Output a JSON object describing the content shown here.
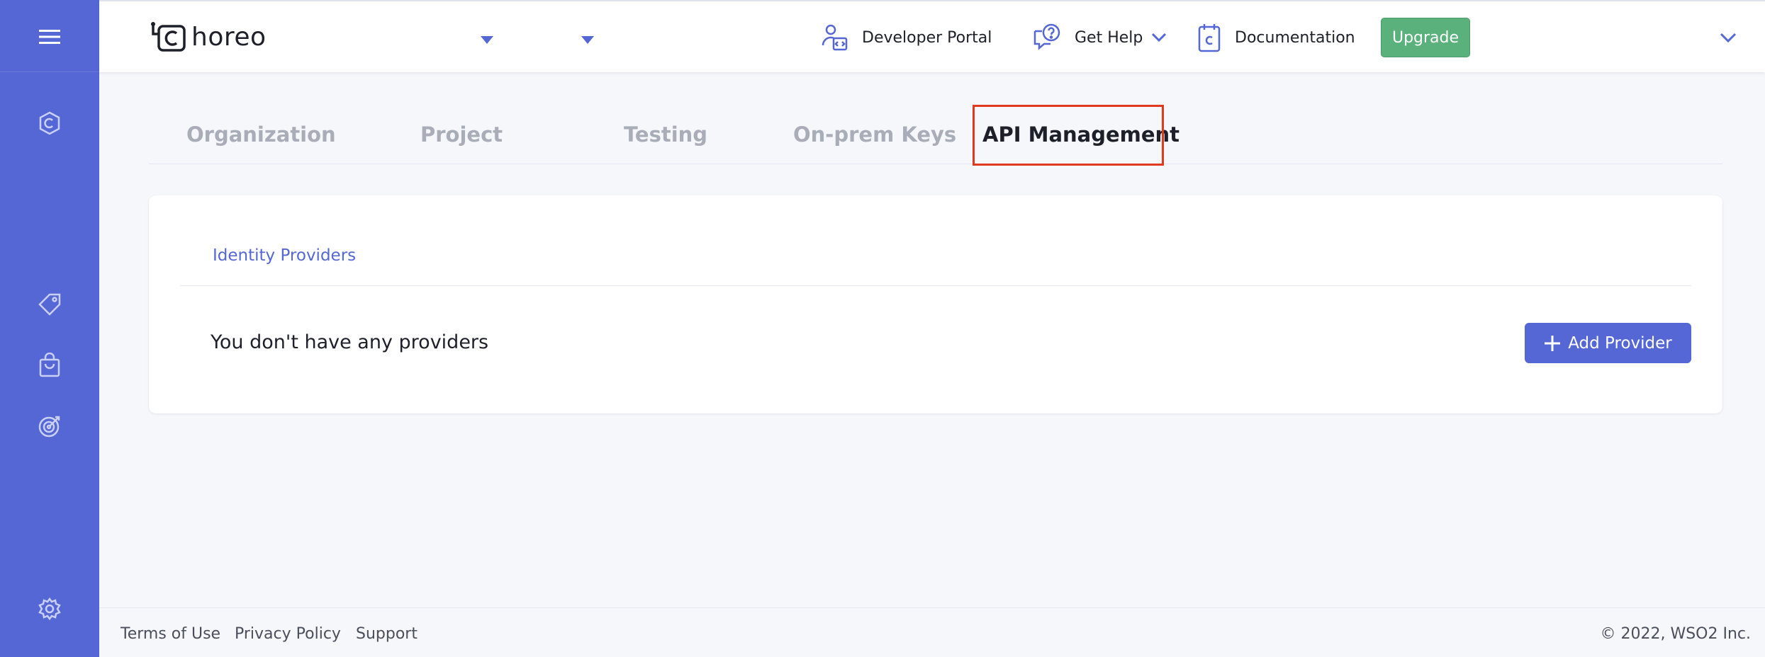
{
  "app": {
    "logo_text": "horeo"
  },
  "header": {
    "developer_portal": "Developer Portal",
    "get_help": "Get Help",
    "documentation": "Documentation",
    "upgrade": "Upgrade"
  },
  "tabs": [
    {
      "label": "Organization",
      "active": false
    },
    {
      "label": "Project",
      "active": false
    },
    {
      "label": "Testing",
      "active": false
    },
    {
      "label": "On-prem Keys",
      "active": false
    },
    {
      "label": "API Management",
      "active": true
    }
  ],
  "card": {
    "subtab": "Identity Providers",
    "empty_message": "You don't have any providers",
    "add_button": "Add Provider"
  },
  "footer": {
    "links": [
      "Terms of Use",
      "Privacy Policy",
      "Support"
    ],
    "copyright": "©  2022, WSO2 Inc."
  },
  "colors": {
    "sidebar": "#5567d5",
    "accent": "#5567d5",
    "upgrade": "#5ab17b",
    "highlight": "#e0391d"
  },
  "icons": {
    "sidebar": [
      "menu-icon",
      "choreo-home-icon",
      "tag-icon",
      "marketplace-bag-icon",
      "target-icon",
      "settings-gear-icon"
    ],
    "header": [
      "developer-portal-icon",
      "help-chat-icon",
      "documentation-icon",
      "chevron-down-icon"
    ]
  }
}
